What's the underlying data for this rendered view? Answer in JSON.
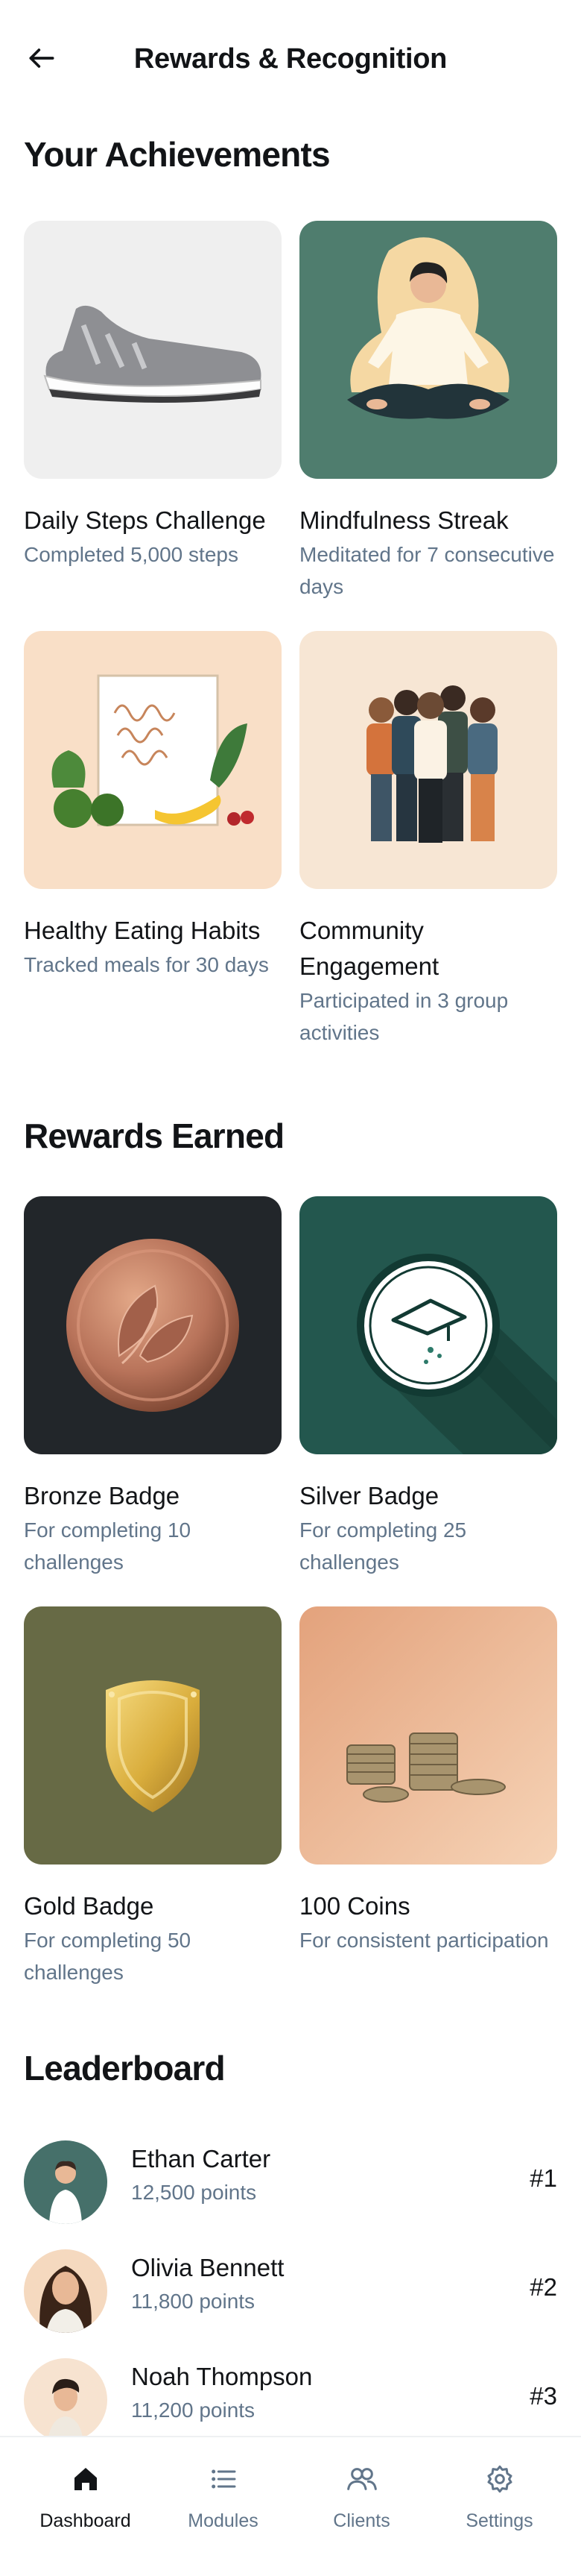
{
  "header": {
    "title": "Rewards & Recognition"
  },
  "achievements": {
    "title": "Your Achievements",
    "items": [
      {
        "title": "Daily Steps Challenge",
        "subtitle": "Completed 5,000 steps",
        "icon": "sneaker"
      },
      {
        "title": "Mindfulness Streak",
        "subtitle": "Meditated for 7 consecutive days",
        "icon": "meditation"
      },
      {
        "title": "Healthy Eating Habits",
        "subtitle": "Tracked meals for 30 days",
        "icon": "healthy-food"
      },
      {
        "title": "Community Engagement",
        "subtitle": "Participated in 3 group activities",
        "icon": "group-of-people"
      }
    ]
  },
  "rewards": {
    "title": "Rewards Earned",
    "items": [
      {
        "title": "Bronze Badge",
        "subtitle": "For completing 10 challenges",
        "icon": "bronze-coin"
      },
      {
        "title": "Silver Badge",
        "subtitle": "For completing 25 challenges",
        "icon": "graduation-cap-badge"
      },
      {
        "title": "Gold Badge",
        "subtitle": "For completing 50 challenges",
        "icon": "gold-shield"
      },
      {
        "title": "100 Coins",
        "subtitle": "For consistent participation",
        "icon": "coin-stacks"
      }
    ]
  },
  "leaderboard": {
    "title": "Leaderboard",
    "entries": [
      {
        "name": "Ethan Carter",
        "points": "12,500 points",
        "rank": "#1"
      },
      {
        "name": "Olivia Bennett",
        "points": "11,800 points",
        "rank": "#2"
      },
      {
        "name": "Noah Thompson",
        "points": "11,200 points",
        "rank": "#3"
      }
    ]
  },
  "nav": {
    "items": [
      {
        "label": "Dashboard",
        "icon": "home-icon",
        "active": true
      },
      {
        "label": "Modules",
        "icon": "list-icon",
        "active": false
      },
      {
        "label": "Clients",
        "icon": "users-icon",
        "active": false
      },
      {
        "label": "Settings",
        "icon": "gear-icon",
        "active": false
      }
    ]
  },
  "colors": {
    "text_primary": "#121417",
    "text_secondary": "#61758a",
    "nav_border": "#eef0f2"
  }
}
